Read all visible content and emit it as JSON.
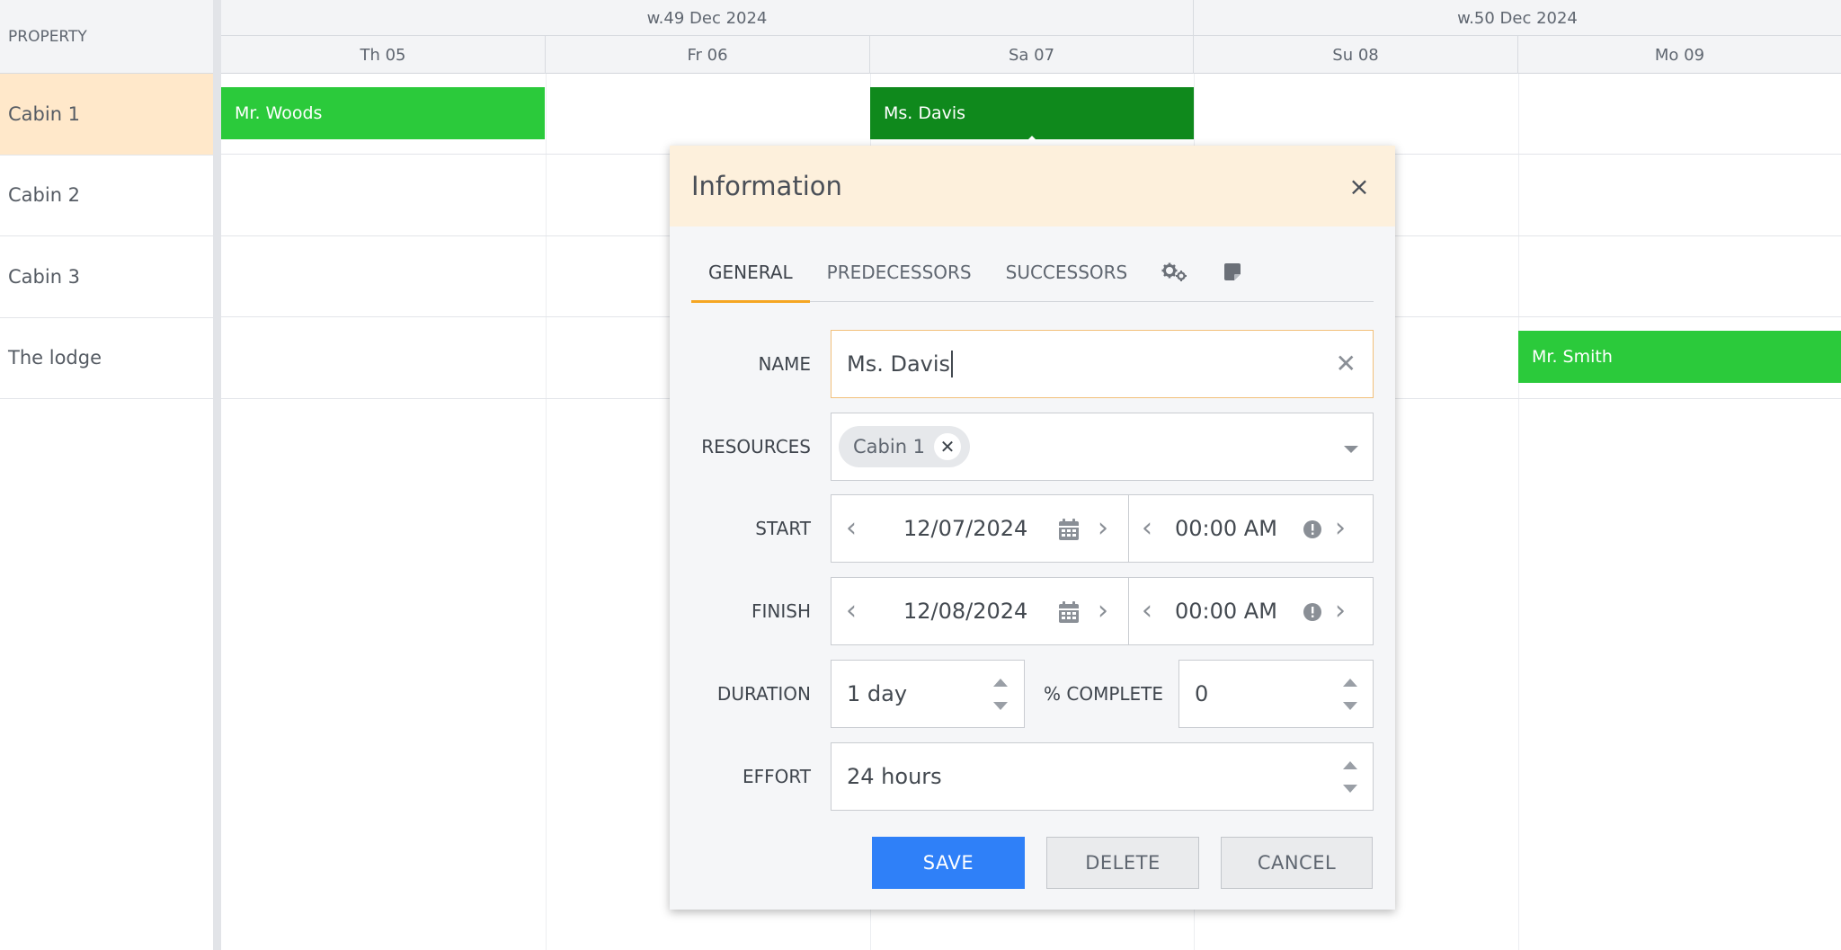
{
  "left_grid": {
    "header": "PROPERTY",
    "resources": [
      "Cabin 1",
      "Cabin 2",
      "Cabin 3",
      "The lodge"
    ]
  },
  "timeline": {
    "weeks": [
      "w.49 Dec 2024",
      "w.50 Dec 2024"
    ],
    "days": [
      "Th 05",
      "Fr 06",
      "Sa 07",
      "Su 08",
      "Mo 09"
    ],
    "events": [
      "Mr. Woods",
      "Ms. Davis",
      "Mr. Smith"
    ]
  },
  "popup": {
    "title": "Information",
    "close_icon": "×",
    "tabs": [
      "GENERAL",
      "PREDECESSORS",
      "SUCCESSORS"
    ],
    "tab_icons": [
      "gears-icon",
      "note-icon"
    ],
    "labels": {
      "name": "NAME",
      "resources": "RESOURCES",
      "start": "START",
      "finish": "FINISH",
      "duration": "DURATION",
      "percent_complete": "% COMPLETE",
      "effort": "EFFORT"
    },
    "values": {
      "name": "Ms. Davis",
      "resource_chip": "Cabin 1",
      "start_date": "12/07/2024",
      "start_time": "00:00 AM",
      "finish_date": "12/08/2024",
      "finish_time": "00:00 AM",
      "duration": "1 day",
      "percent_complete": "0",
      "effort": "24 hours"
    },
    "buttons": {
      "save": "SAVE",
      "delete": "DELETE",
      "cancel": "CANCEL"
    }
  },
  "colors": {
    "accent_blue": "#2f80f8",
    "event_green": "#2bca3b",
    "event_dark_green": "#0f891c",
    "selected_row": "#ffe8ca",
    "popup_header": "#fdf0dc",
    "tab_underline": "#f5a623"
  }
}
